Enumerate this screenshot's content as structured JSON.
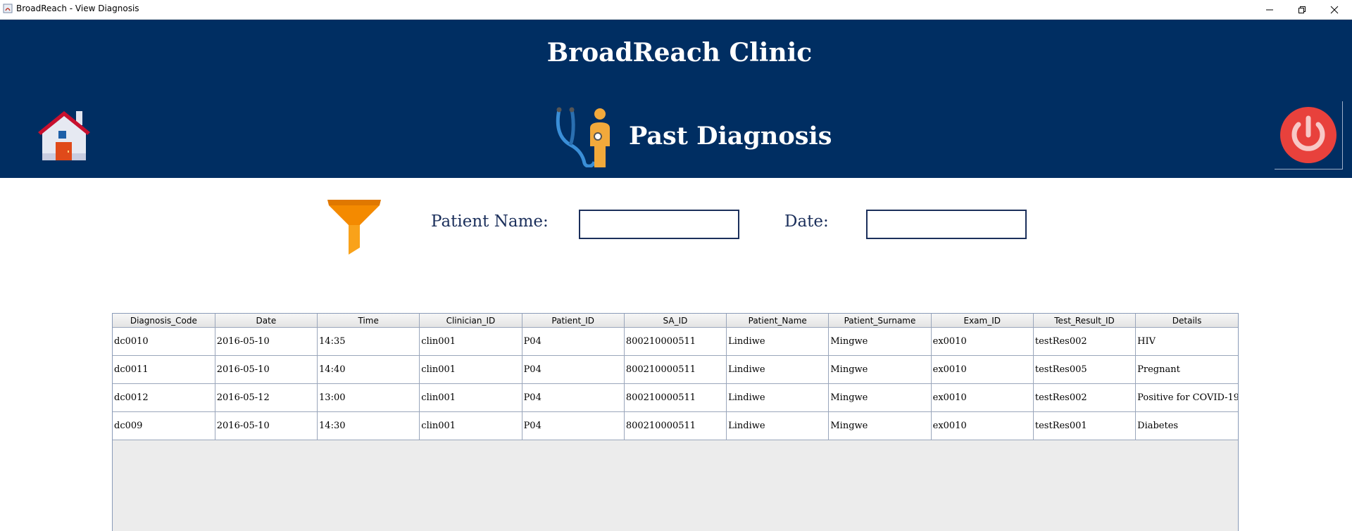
{
  "window": {
    "title": "BroadReach - View Diagnosis"
  },
  "header": {
    "clinic_name": "BroadReach Clinic",
    "page_title": "Past Diagnosis"
  },
  "filters": {
    "patient_name_label": "Patient Name:",
    "patient_name_value": "",
    "date_label": "Date:",
    "date_value": ""
  },
  "table": {
    "columns": [
      "Diagnosis_Code",
      "Date",
      "Time",
      "Clinician_ID",
      "Patient_ID",
      "SA_ID",
      "Patient_Name",
      "Patient_Surname",
      "Exam_ID",
      "Test_Result_ID",
      "Details"
    ],
    "rows": [
      [
        "dc0010",
        "2016-05-10",
        "14:35",
        "clin001",
        "P04",
        "800210000511",
        "Lindiwe",
        "Mingwe",
        "ex0010",
        "testRes002",
        "HIV"
      ],
      [
        "dc0011",
        "2016-05-10",
        "14:40",
        "clin001",
        "P04",
        "800210000511",
        "Lindiwe",
        "Mingwe",
        "ex0010",
        "testRes005",
        "Pregnant"
      ],
      [
        "dc0012",
        "2016-05-12",
        "13:00",
        "clin001",
        "P04",
        "800210000511",
        "Lindiwe",
        "Mingwe",
        "ex0010",
        "testRes002",
        "Positive for COVID-19"
      ],
      [
        "dc009",
        "2016-05-10",
        "14:30",
        "clin001",
        "P04",
        "800210000511",
        "Lindiwe",
        "Mingwe",
        "ex0010",
        "testRes001",
        "Diabetes"
      ]
    ]
  },
  "colors": {
    "header_bg": "#002e62",
    "label_color": "#1b2f5b",
    "power_red": "#e8413c",
    "filter_orange": "#f48a00"
  },
  "icons": {
    "home": "home-icon",
    "diagnosis": "stethoscope-doctor-icon",
    "power": "power-icon",
    "filter": "filter-icon"
  }
}
